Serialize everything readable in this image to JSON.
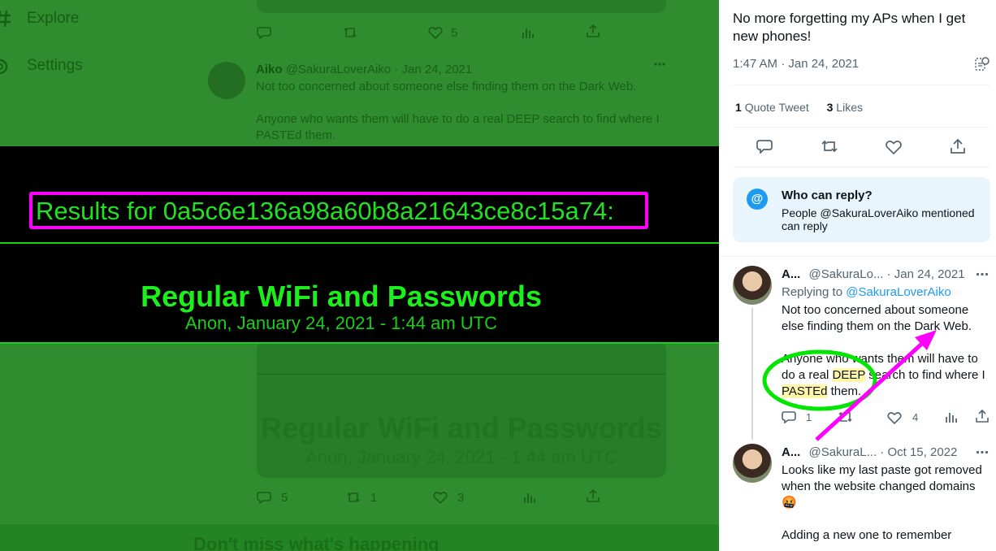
{
  "left": {
    "nav": [
      {
        "label": "Explore",
        "icon": "hashtag-icon"
      },
      {
        "label": "Settings",
        "icon": "gear-icon"
      }
    ],
    "top_actions": {
      "likes": "5"
    },
    "tweet": {
      "name": "Aiko",
      "handle": "@SakuraLoverAiko",
      "date": "· Jan 24, 2021",
      "line1": "Not too concerned about someone else finding them on the Dark Web.",
      "line2": "Anyone who wants them will have to do a real DEEP search to find where I",
      "line3": "PASTEd them."
    },
    "behind_card": {
      "title": "Regular WiFi and Passwords",
      "subtitle": "Anon, January 24, 2021 - 1:44 am UTC"
    },
    "bottom_actions": {
      "replies": "5",
      "retweets": "1",
      "likes": "3"
    },
    "footer_banner": "Don't miss what's happening"
  },
  "banner": {
    "hash_label": "Results for 0a5c6e136a98a60b8a21643ce8c15a74:",
    "title": "Regular WiFi and Passwords",
    "subtitle": "Anon, January 24, 2021 - 1:44 am UTC"
  },
  "right": {
    "post_text_line1": "No more forgetting my APs when I get",
    "post_text_line2": "new phones!",
    "timestamp": "1:47 AM · Jan 24, 2021",
    "stats": {
      "quote_count": "1",
      "quote_label": "Quote Tweet",
      "likes_count": "3",
      "likes_label": "Likes"
    },
    "who_can_reply": {
      "title": "Who can reply?",
      "line1": "People @SakuraLoverAiko mentioned",
      "line2": "can reply"
    },
    "reply1": {
      "name": "A...",
      "handle": "@SakuraLo...",
      "date": "· Jan 24, 2021",
      "replying_prefix": "Replying to ",
      "replying_to": "@SakuraLoverAiko",
      "text1": "Not too concerned about someone",
      "text2": "else finding them on the Dark Web.",
      "text3": "Anyone who wants them will have to",
      "text4a": "do a real ",
      "text4b": "DEEP",
      "text4c": " search to find where I",
      "text5a": "PASTEd",
      "text5b": " them.",
      "reply_count": "1",
      "like_count": "4"
    },
    "reply2": {
      "name": "A...",
      "handle": "@SakuraL...",
      "date": "· Oct 15, 2022",
      "text1": "Looks like my last paste got removed",
      "text2": "when the website changed domains",
      "emoji": "🤬",
      "text3": "Adding a new one to remember"
    }
  },
  "colors": {
    "accent": "#1d9bf0",
    "annotation_magenta": "#ff00ff",
    "annotation_green": "#00e600",
    "terminal_green": "#1cf01c"
  }
}
